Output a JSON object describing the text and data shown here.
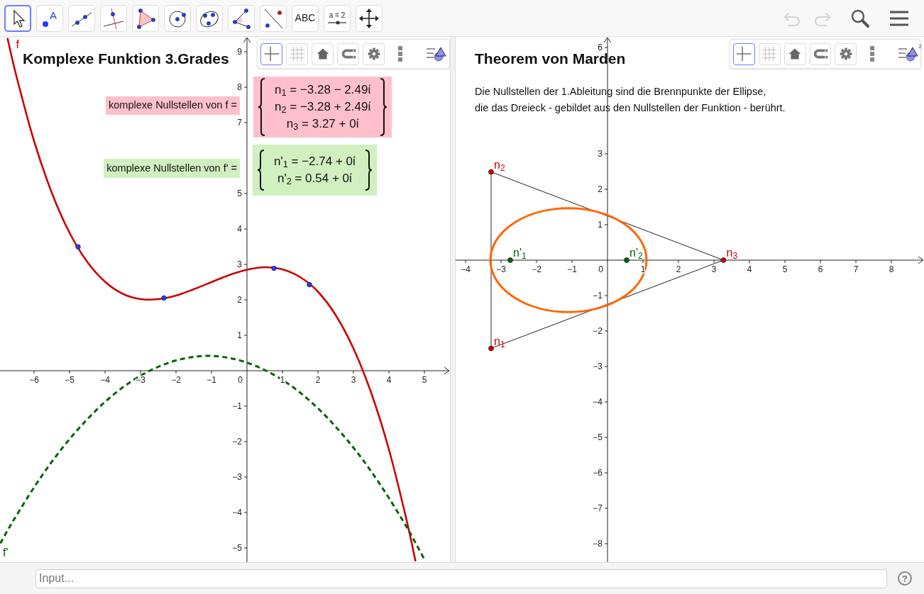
{
  "toolbar": {
    "tools": [
      {
        "kind": "move",
        "selected": true
      },
      {
        "kind": "point",
        "selected": false,
        "label": "A"
      },
      {
        "kind": "line",
        "selected": false
      },
      {
        "kind": "perpendicular",
        "selected": false
      },
      {
        "kind": "polygon",
        "selected": false
      },
      {
        "kind": "circle",
        "selected": false
      },
      {
        "kind": "conic",
        "selected": false
      },
      {
        "kind": "angle",
        "selected": false
      },
      {
        "kind": "reflect",
        "selected": false
      },
      {
        "kind": "text",
        "selected": false,
        "label": "ABC"
      },
      {
        "kind": "slider",
        "selected": false,
        "label": "a = 2"
      },
      {
        "kind": "move_view",
        "selected": false
      }
    ],
    "actions": [
      {
        "kind": "undo",
        "disabled": true
      },
      {
        "kind": "redo",
        "disabled": true
      },
      {
        "kind": "search",
        "disabled": false
      },
      {
        "kind": "menu",
        "disabled": false
      }
    ]
  },
  "views": [
    {
      "title": "Komplexe Funktion 3.Grades",
      "style_bar": [
        {
          "kind": "axes",
          "selected": true
        },
        {
          "kind": "grid",
          "selected": false
        },
        {
          "kind": "home",
          "selected": false
        },
        {
          "kind": "magnet",
          "selected": false
        },
        {
          "kind": "gear",
          "selected": false
        },
        {
          "kind": "more",
          "selected": false
        },
        {
          "kind": "style",
          "selected": false
        }
      ],
      "boxes": [
        {
          "kind": "label",
          "color": "#ffc0cb",
          "text": "komplexe Nullstellen von f ="
        },
        {
          "kind": "formula",
          "color": "#ffc0cb",
          "lines": [
            "n$_{1}$ = −3.28 − 2.49ί",
            "n$_{2}$ = −3.28 + 2.49ί",
            "n$_{3}$ = 3.27 + 0ί"
          ]
        },
        {
          "kind": "label",
          "color": "#d0f0c0",
          "text": "komplexe Nullstellen von f' ="
        },
        {
          "kind": "formula",
          "color": "#d0f0c0",
          "lines": [
            "n'$_{1}$ = −2.74 + 0ί",
            "n'$_{2}$ = 0.54 + 0ί"
          ]
        }
      ],
      "origin_label": "0",
      "chart_data": {
        "type": "line",
        "xlim": [
          -6.96,
          5.72
        ],
        "ylim": [
          -5.4,
          9.42
        ],
        "xticks": [
          {
            "value": -6,
            "label": "−6"
          },
          {
            "value": -5,
            "label": "−5"
          },
          {
            "value": -4,
            "label": "−4"
          },
          {
            "value": -3,
            "label": "−3"
          },
          {
            "value": -2,
            "label": "−2"
          },
          {
            "value": -1,
            "label": "−1"
          },
          {
            "value": 1,
            "label": "1"
          },
          {
            "value": 2,
            "label": "2"
          },
          {
            "value": 3,
            "label": "3"
          },
          {
            "value": 4,
            "label": "4"
          },
          {
            "value": 5,
            "label": "5"
          }
        ],
        "yticks": [
          {
            "value": 9,
            "label": "9"
          },
          {
            "value": 8,
            "label": "8"
          },
          {
            "value": 7,
            "label": "7"
          },
          {
            "value": 5,
            "label": "5"
          },
          {
            "value": 4,
            "label": "4"
          },
          {
            "value": 3,
            "label": "3"
          },
          {
            "value": 2,
            "label": "2"
          },
          {
            "value": 1,
            "label": "1"
          },
          {
            "value": -1,
            "label": "−1"
          },
          {
            "value": -2,
            "label": "−2"
          },
          {
            "value": -3,
            "label": "−3"
          },
          {
            "value": -4,
            "label": "−4"
          },
          {
            "value": -5,
            "label": "−5"
          }
        ],
        "x": [
          -6.95,
          -6.75,
          -6.5,
          -6,
          -5.5,
          -5,
          -4.5,
          -4,
          -3.5,
          -3,
          -2.5,
          -2,
          -1.5,
          -1,
          -0.5,
          0,
          0.5,
          1,
          1.5,
          2,
          2.5,
          3,
          3.5,
          4,
          4.5,
          4.75,
          5
        ],
        "series": [
          {
            "name": "f",
            "color": "#cc0000",
            "line_style": "solid",
            "values": [
              null,
              9.39,
              8.32,
              6.48,
              5.02,
              3.89,
              3.07,
              2.51,
              2.17,
              2.02,
              2.02,
              2.12,
              2.3,
              2.5,
              2.7,
              2.85,
              2.92,
              2.86,
              2.64,
              2.23,
              1.57,
              0.63,
              -0.62,
              -2.22,
              -4.22,
              -5.38,
              null
            ]
          },
          {
            "name": "f'",
            "color": "#006400",
            "line_style": "dashed",
            "values": [
              -4.87,
              -4.51,
              -4.09,
              -3.29,
              -2.57,
              -1.93,
              -1.37,
              -0.88,
              -0.47,
              -0.14,
              0.11,
              0.29,
              0.39,
              0.42,
              0.36,
              0.23,
              0.02,
              -0.26,
              -0.62,
              -1.06,
              -1.58,
              -2.17,
              -2.84,
              -3.59,
              -4.41,
              -4.86,
              -5.32
            ]
          }
        ]
      }
    },
    {
      "title": "Theorem von Marden",
      "style_bar": [
        {
          "kind": "axes",
          "selected": true
        },
        {
          "kind": "grid",
          "selected": false
        },
        {
          "kind": "home",
          "selected": false
        },
        {
          "kind": "magnet",
          "selected": false
        },
        {
          "kind": "gear",
          "selected": false
        },
        {
          "kind": "more",
          "selected": false
        },
        {
          "kind": "style",
          "selected": false,
          "label": "2"
        }
      ],
      "description": "Die Nullstellen der 1.Ableitung sind die Brennpunkte der Ellipse,\ndie das Dreieck - gebildet aus den Nullstellen der Funktion - berührt.",
      "origin_label": "0",
      "chart_data": {
        "type": "scatter",
        "xlim": [
          -4.28,
          8.92
        ],
        "ylim": [
          -8.52,
          6.3
        ],
        "xticks": [
          {
            "value": -4,
            "label": "−4"
          },
          {
            "value": -3,
            "label": "−3"
          },
          {
            "value": -2,
            "label": "−2"
          },
          {
            "value": -1,
            "label": "−1"
          },
          {
            "value": 1,
            "label": "1"
          },
          {
            "value": 2,
            "label": "2"
          },
          {
            "value": 3,
            "label": "3"
          },
          {
            "value": 4,
            "label": "4"
          },
          {
            "value": 5,
            "label": "5"
          },
          {
            "value": 6,
            "label": "6"
          },
          {
            "value": 7,
            "label": "7"
          },
          {
            "value": 8,
            "label": "8"
          }
        ],
        "yticks": [
          {
            "value": 6,
            "label": "6"
          },
          {
            "value": 3,
            "label": "3"
          },
          {
            "value": 2,
            "label": "2"
          },
          {
            "value": 1,
            "label": "1"
          },
          {
            "value": -1,
            "label": "−1"
          },
          {
            "value": -2,
            "label": "−2"
          },
          {
            "value": -3,
            "label": "−3"
          },
          {
            "value": -4,
            "label": "−4"
          },
          {
            "value": -5,
            "label": "−5"
          },
          {
            "value": -6,
            "label": "−6"
          },
          {
            "value": -7,
            "label": "−7"
          },
          {
            "value": -8,
            "label": "−8"
          }
        ],
        "series": [
          {
            "name": "n$_{1}$",
            "color": "#cc0000",
            "x": [
              -3.28
            ],
            "values": [
              -2.49
            ]
          },
          {
            "name": "n$_{2}$",
            "color": "#cc0000",
            "x": [
              -3.28
            ],
            "values": [
              2.49
            ]
          },
          {
            "name": "n$_{3}$",
            "color": "#cc0000",
            "x": [
              3.27
            ],
            "values": [
              0
            ]
          },
          {
            "name": "n'$_{1}$",
            "color": "#006400",
            "x": [
              -2.74
            ],
            "values": [
              0
            ]
          },
          {
            "name": "n'$_{2}$",
            "color": "#006400",
            "x": [
              0.54
            ],
            "values": [
              0
            ]
          }
        ]
      }
    }
  ],
  "input_bar": {
    "placeholder": "Input...",
    "help": "?"
  }
}
